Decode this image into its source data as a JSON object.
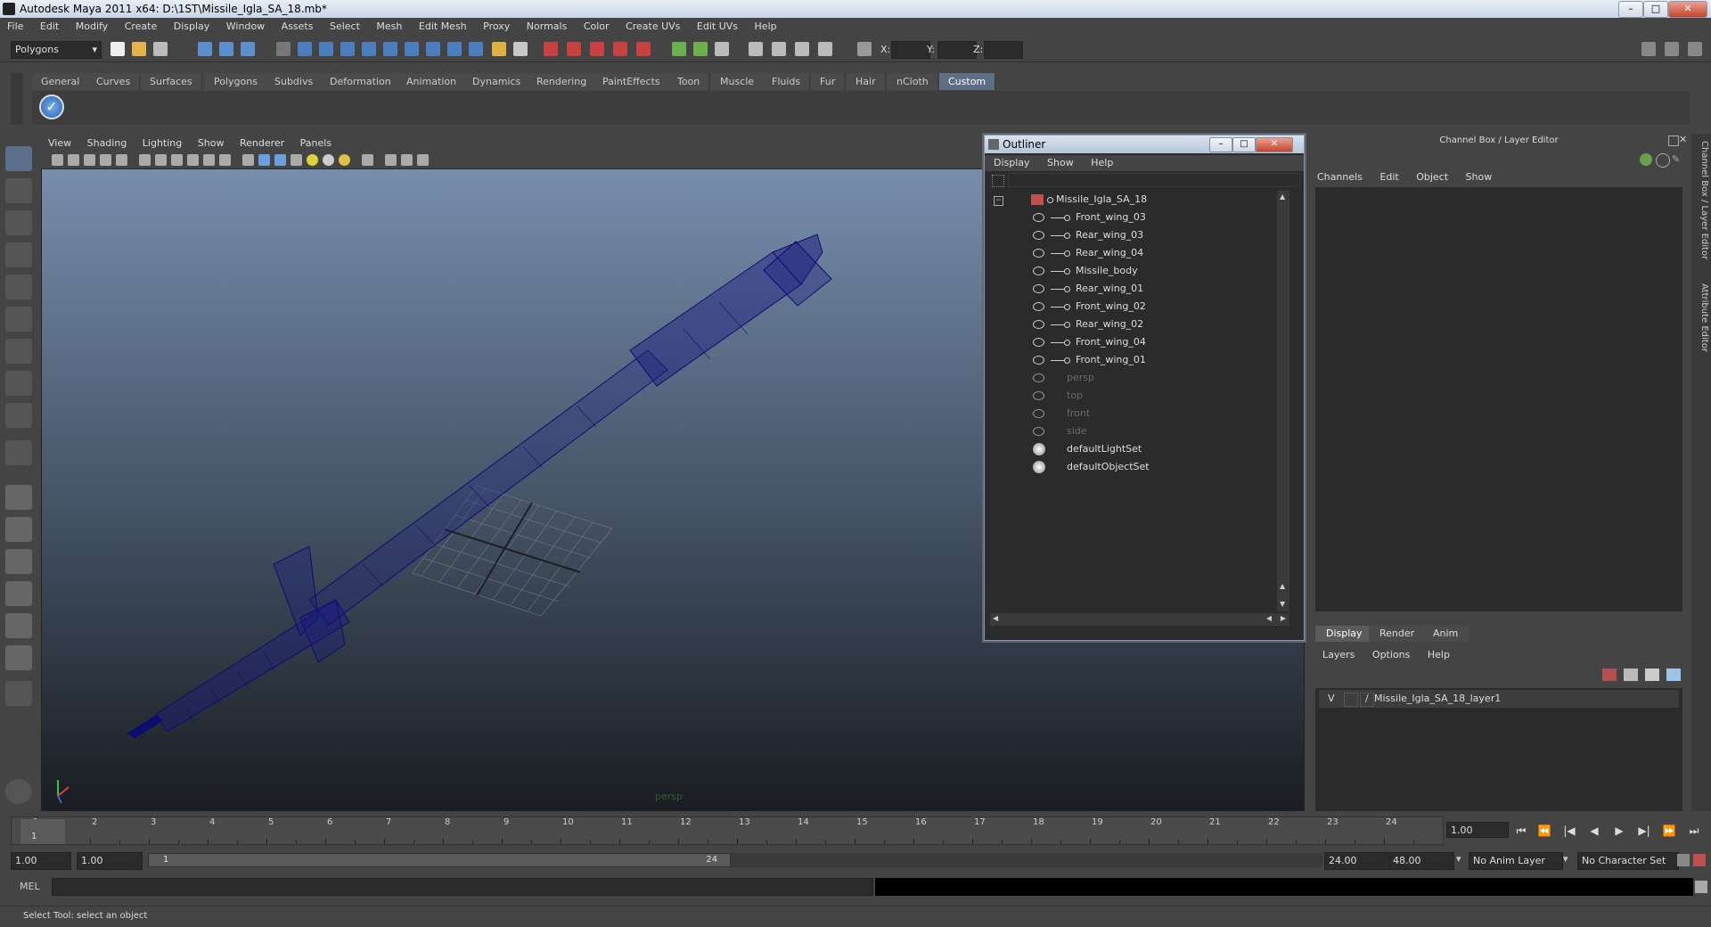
{
  "window": {
    "title": "Autodesk Maya 2011 x64: D:\\1ST\\Missile_Igla_SA_18.mb*"
  },
  "menubar": [
    "File",
    "Edit",
    "Modify",
    "Create",
    "Display",
    "Window",
    "Assets",
    "Select",
    "Mesh",
    "Edit Mesh",
    "Proxy",
    "Normals",
    "Color",
    "Create UVs",
    "Edit UVs",
    "Help"
  ],
  "statusline": {
    "mode": "Polygons",
    "x_label": "X:",
    "y_label": "Y:",
    "z_label": "Z:"
  },
  "shelf": {
    "tabs": [
      "General",
      "Curves",
      "Surfaces",
      "Polygons",
      "Subdivs",
      "Deformation",
      "Animation",
      "Dynamics",
      "Rendering",
      "PaintEffects",
      "Toon",
      "Muscle",
      "Fluids",
      "Fur",
      "Hair",
      "nCloth",
      "Custom"
    ],
    "active": "Custom"
  },
  "viewport": {
    "menu": [
      "View",
      "Shading",
      "Lighting",
      "Show",
      "Renderer",
      "Panels"
    ],
    "camera_label": "persp"
  },
  "outliner": {
    "title": "Outliner",
    "menu": [
      "Display",
      "Show",
      "Help"
    ],
    "items": [
      {
        "label": "Missile_Igla_SA_18",
        "type": "root"
      },
      {
        "label": "Front_wing_03",
        "type": "child"
      },
      {
        "label": "Rear_wing_03",
        "type": "child"
      },
      {
        "label": "Rear_wing_04",
        "type": "child"
      },
      {
        "label": "Missile_body",
        "type": "child"
      },
      {
        "label": "Rear_wing_01",
        "type": "child"
      },
      {
        "label": "Front_wing_02",
        "type": "child"
      },
      {
        "label": "Rear_wing_02",
        "type": "child"
      },
      {
        "label": "Front_wing_04",
        "type": "child"
      },
      {
        "label": "Front_wing_01",
        "type": "child"
      },
      {
        "label": "persp",
        "type": "camera"
      },
      {
        "label": "top",
        "type": "camera"
      },
      {
        "label": "front",
        "type": "camera"
      },
      {
        "label": "side",
        "type": "camera"
      },
      {
        "label": "defaultLightSet",
        "type": "set"
      },
      {
        "label": "defaultObjectSet",
        "type": "set"
      }
    ]
  },
  "channelbox": {
    "title": "Channel Box / Layer Editor",
    "menu": [
      "Channels",
      "Edit",
      "Object",
      "Show"
    ],
    "layer_tabs": [
      "Display",
      "Render",
      "Anim"
    ],
    "layer_menu": [
      "Layers",
      "Options",
      "Help"
    ],
    "layer": {
      "visible": "V",
      "name": "Missile_Igla_SA_18_layer1"
    }
  },
  "side_tabs": [
    "Channel Box / Layer Editor",
    "Attribute Editor"
  ],
  "timeslider": {
    "ticks": [
      "1",
      "2",
      "3",
      "4",
      "5",
      "6",
      "7",
      "8",
      "9",
      "10",
      "11",
      "12",
      "13",
      "14",
      "15",
      "16",
      "17",
      "18",
      "19",
      "20",
      "21",
      "22",
      "23",
      "24"
    ],
    "current_marker": "1",
    "current_frame": "1.00"
  },
  "range": {
    "start_time": "1.00",
    "start_range": "1.00",
    "slider_start": "1",
    "slider_end": "24",
    "end_range": "24.00",
    "end_time": "48.00",
    "anim_layer": "No Anim Layer",
    "character_set": "No Character Set"
  },
  "cmdline": {
    "label": "MEL"
  },
  "helpline": {
    "text": "Select Tool: select an object"
  },
  "colors": {
    "wireframe": "#0d0d6e",
    "viewport_top": "#7c93b3",
    "viewport_bottom": "#1a1d22",
    "active_tab": "#5e6e85"
  }
}
